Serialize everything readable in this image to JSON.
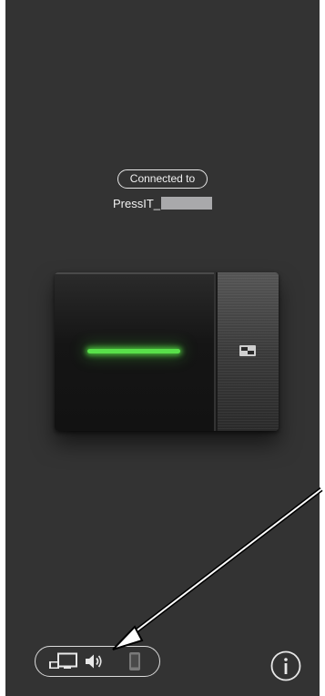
{
  "status": {
    "connected_label": "Connected to",
    "device_prefix": "PressIT_"
  },
  "device": {
    "led_color": "#58e04a",
    "led_state": "connected"
  },
  "bottom_bar": {
    "icons": [
      "screen-share-icon",
      "speaker-icon",
      "phone-icon"
    ],
    "info_icon": "info-icon"
  },
  "colors": {
    "background": "#333333",
    "text": "#f0f0f0",
    "redaction": "#a9a9ab"
  }
}
